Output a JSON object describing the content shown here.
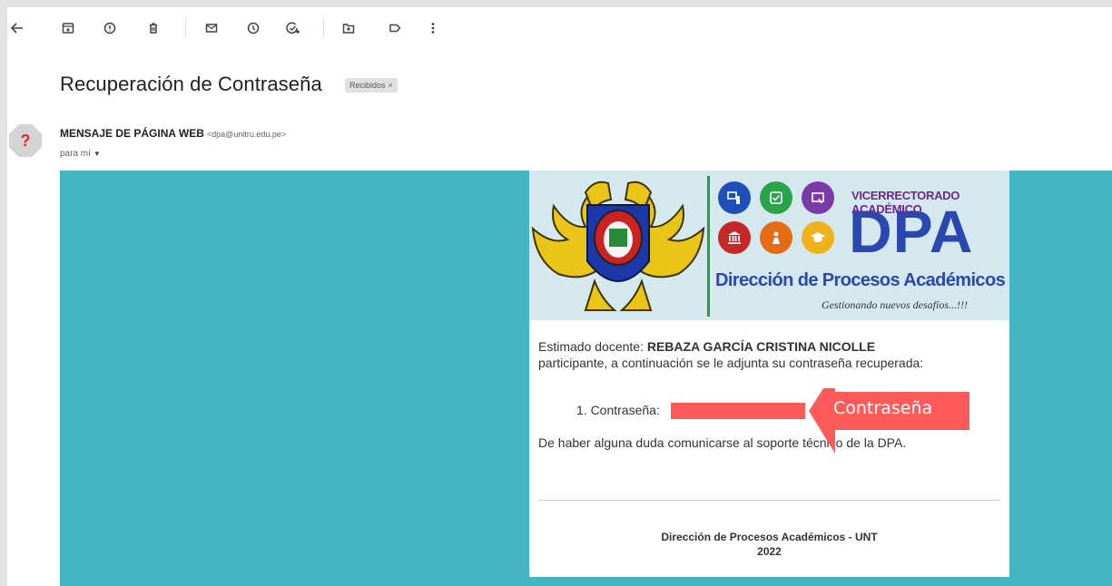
{
  "toolbar": {
    "icons": [
      "back-arrow-icon",
      "archive-icon",
      "report-spam-icon",
      "delete-icon",
      "mark-unread-icon",
      "snooze-icon",
      "add-task-icon",
      "move-to-icon",
      "label-icon",
      "more-vertical-icon"
    ]
  },
  "email": {
    "subject": "Recuperación de Contraseña",
    "label_chip": "Recibidos",
    "label_chip_close": "×",
    "sender_name": "MENSAJE DE PÁGINA WEB",
    "sender_email": "<dpa@unitru.edu.pe>",
    "recipient": "para mí",
    "avatar_glyph": "?"
  },
  "banner": {
    "header": "VICERRECTORADO ACADÉMICO",
    "acronym": "DPA",
    "department": "Dirección de Procesos Académicos",
    "slogan": "Gestionando nuevos desafíos...!!!"
  },
  "message": {
    "greeting": "Estimado docente: ",
    "teacher_name": "REBAZA GARCÍA CRISTINA NICOLLE",
    "line2": "participante, a continuación se le adjunta su contraseña recuperada:",
    "list_item": "1. Contraseña:",
    "doubt": "De haber alguna duda comunicarse al soporte técnico de la DPA.",
    "footer_line1": "Dirección de Procesos Académicos - UNT",
    "footer_line2": "2022"
  },
  "annotation": {
    "label": "Contraseña",
    "color": "#ff5a5a"
  },
  "colors": {
    "message_background": "#45b6c1",
    "banner_background": "#d4e8ee",
    "dpa_blue": "#2a48b0"
  }
}
